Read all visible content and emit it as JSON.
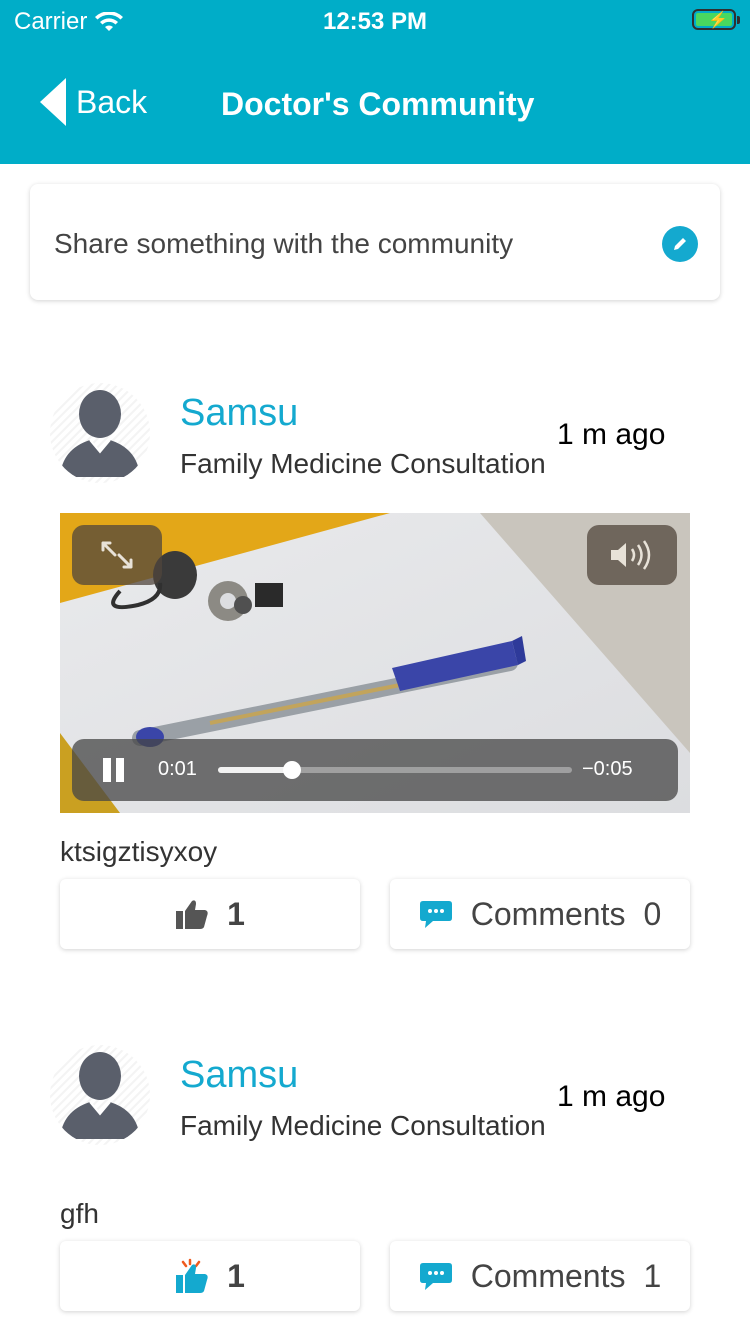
{
  "status_bar": {
    "carrier": "Carrier",
    "time": "12:53 PM"
  },
  "nav": {
    "back_label": "Back",
    "title": "Doctor's Community"
  },
  "composer": {
    "placeholder": "Share something with the community"
  },
  "posts": [
    {
      "author": "Samsu",
      "specialty": "Family Medicine Consultation",
      "time_ago": "1 m ago",
      "video": {
        "elapsed": "0:01",
        "remaining": "−0:05",
        "progress": 0.21
      },
      "text": "ktsigztisyxoy",
      "likes": "1",
      "comments_label": "Comments",
      "comments_count": "0"
    },
    {
      "author": "Samsu",
      "specialty": "Family Medicine Consultation",
      "time_ago": "1 m ago",
      "text": "gfh",
      "likes": "1",
      "comments_label": "Comments",
      "comments_count": "1"
    }
  ],
  "colors": {
    "accent": "#00adc8",
    "link": "#14a9cf",
    "liked": "#14a9cf"
  }
}
